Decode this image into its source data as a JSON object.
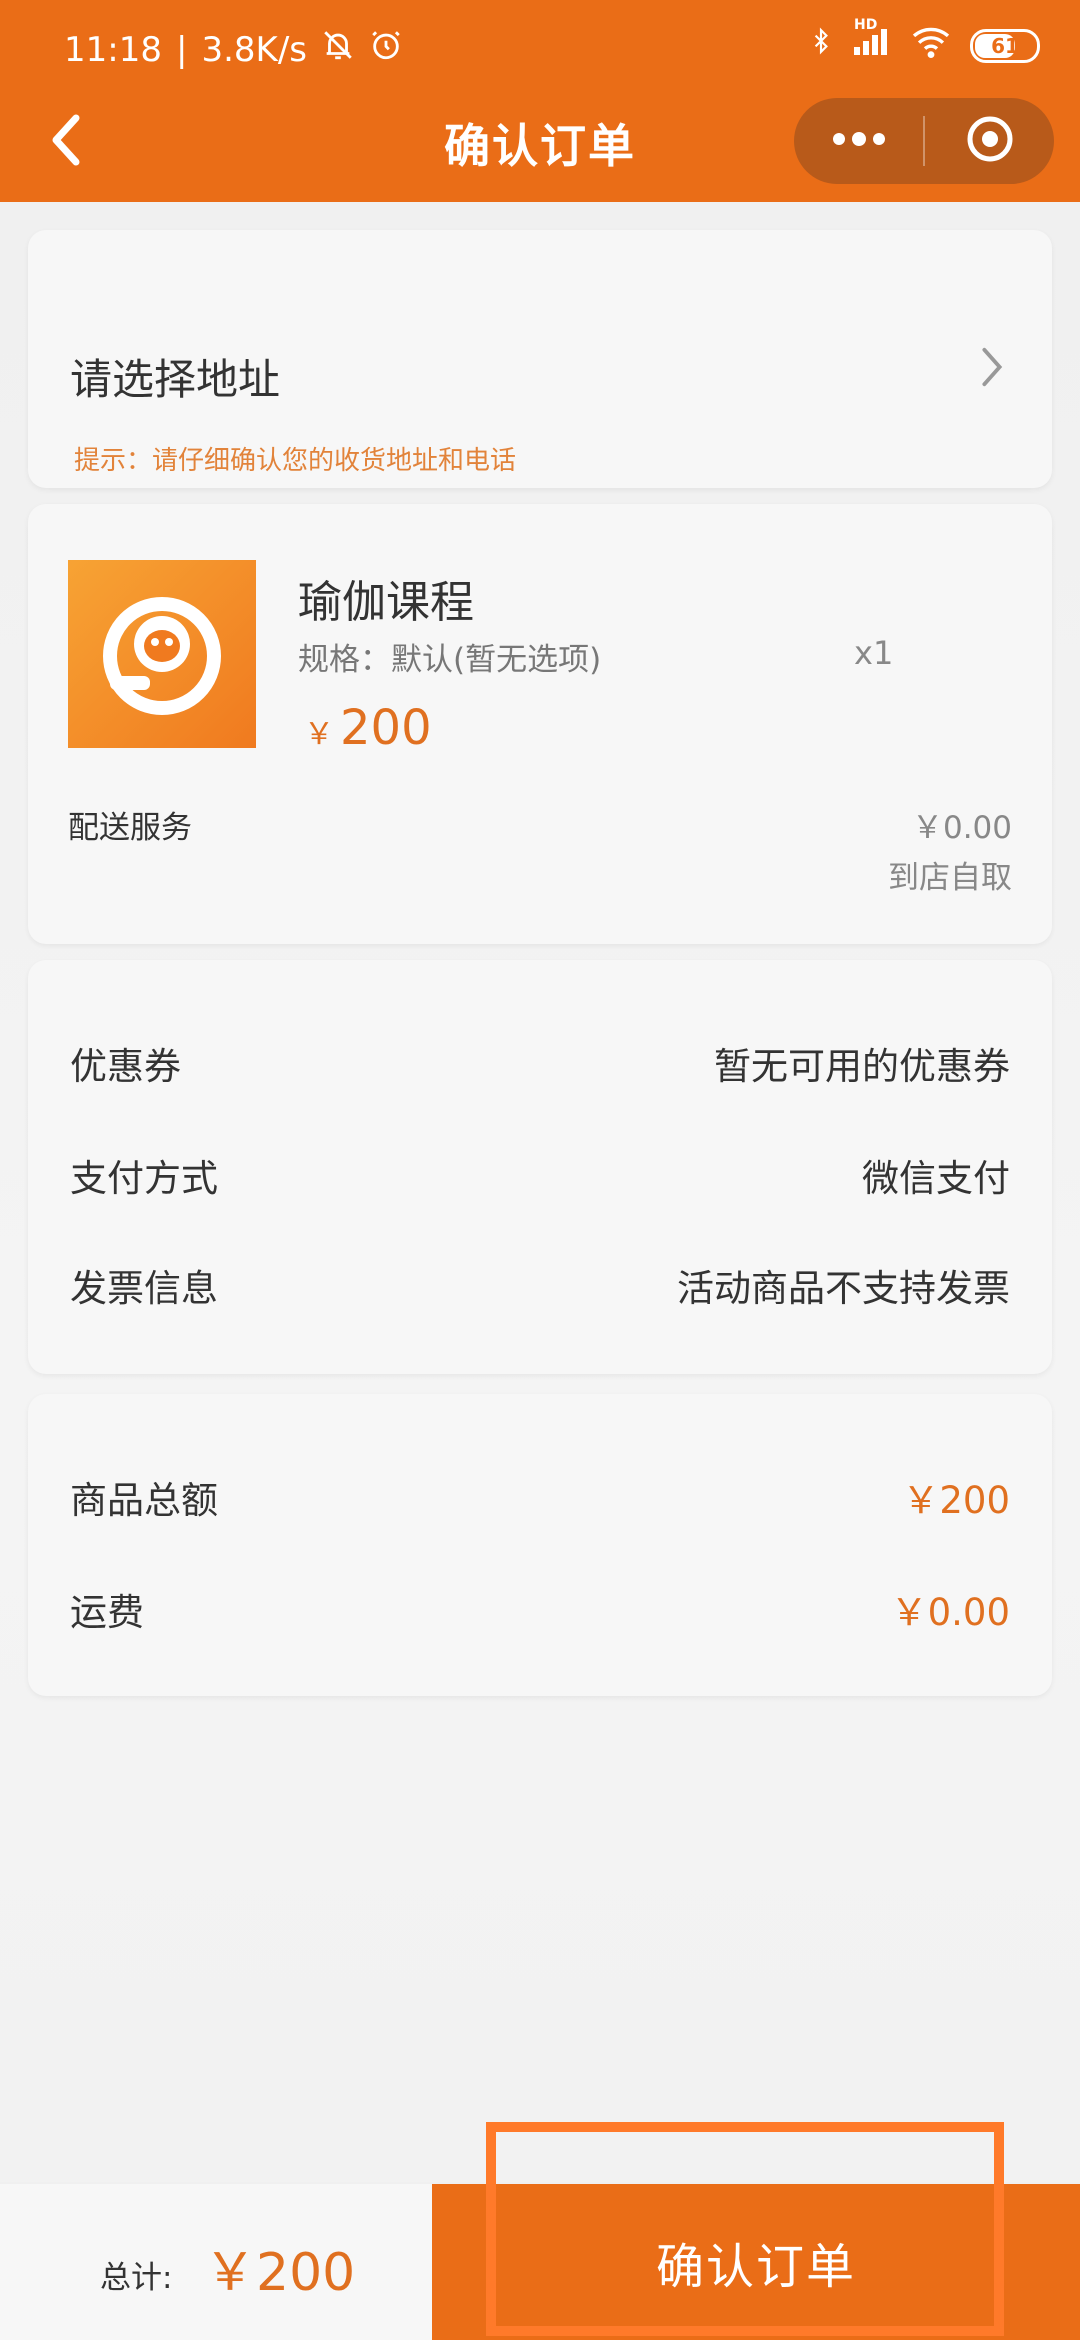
{
  "status_bar": {
    "time": "11:18",
    "separator": "|",
    "network_speed": "3.8K/s",
    "network_label": "HD",
    "battery": "61",
    "icons": [
      "bell-off-icon",
      "alarm-icon",
      "bluetooth-icon",
      "signal-icon",
      "wifi-icon",
      "battery-icon"
    ]
  },
  "header": {
    "title": "确认订单",
    "back_icon": "chevron-left-icon",
    "more_icon": "more-icon",
    "close_icon": "target-icon",
    "accent": "#ea6d17"
  },
  "address": {
    "title": "请选择地址",
    "tip": "提示：请仔细确认您的收货地址和电话"
  },
  "product": {
    "name": "瑜伽课程",
    "spec": "规格：默认(暂无选项)",
    "quantity": "x1",
    "currency": "￥",
    "price": "200",
    "delivery_label": "配送服务",
    "delivery_fee": "￥0.00",
    "delivery_mode": "到店自取"
  },
  "options": [
    {
      "label": "优惠券",
      "value": "暂无可用的优惠券"
    },
    {
      "label": "支付方式",
      "value": "微信支付"
    },
    {
      "label": "发票信息",
      "value": "活动商品不支持发票"
    }
  ],
  "summary": [
    {
      "label": "商品总额",
      "value": "￥200"
    },
    {
      "label": "运费",
      "value": "￥0.00"
    }
  ],
  "footer": {
    "total_label": "总计:",
    "total_value": "￥200",
    "confirm_label": "确认订单"
  }
}
